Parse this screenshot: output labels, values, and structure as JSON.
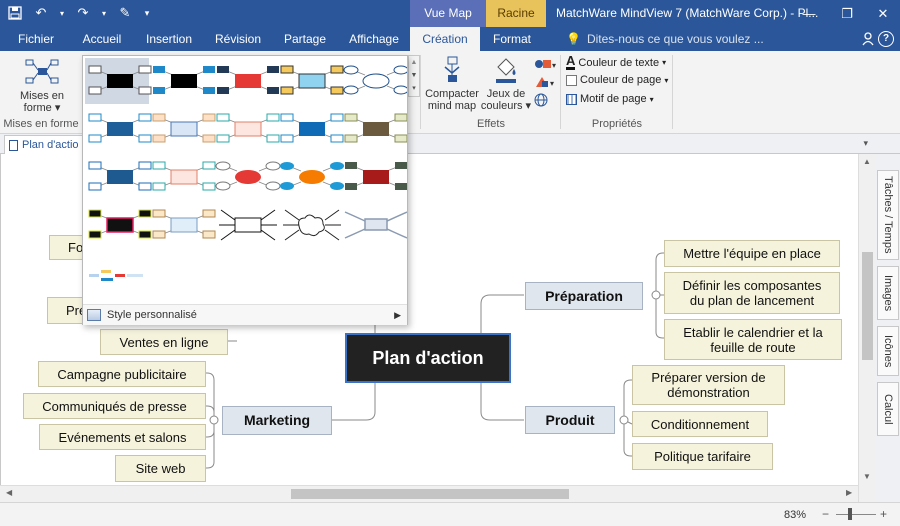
{
  "titlebar": {
    "title": "MatchWare MindView 7 (MatchWare Corp.) - Pl...",
    "context_group_left": "Vue Map",
    "context_group_right": "Racine",
    "color": "#2b579a"
  },
  "tabs": [
    {
      "label": "Fichier"
    },
    {
      "label": "Accueil"
    },
    {
      "label": "Insertion"
    },
    {
      "label": "Révision"
    },
    {
      "label": "Partage"
    },
    {
      "label": "Affichage"
    },
    {
      "label": "Création"
    },
    {
      "label": "Format"
    }
  ],
  "tellme": "Dites-nous ce que vous voulez ...",
  "ribbon": {
    "mises_en_forme_line1": "Mises en",
    "mises_en_forme_line2": "forme",
    "group_mises": "Mises en forme",
    "compacter_line1": "Compacter",
    "compacter_line2": "mind map",
    "jeux_line1": "Jeux de",
    "jeux_line2": "couleurs",
    "group_effets": "Effets",
    "couleur_texte": "Couleur de texte",
    "couleur_page": "Couleur de page",
    "motif_page": "Motif de page",
    "group_proprietes": "Propriétés"
  },
  "doc_tab": "Plan d'actio",
  "gallery": {
    "footer": "Style personnalisé"
  },
  "map": {
    "root": "Plan d'action",
    "branches": {
      "preparation": "Préparation",
      "produit": "Produit",
      "marketing": "Marketing"
    },
    "preparation_items": [
      "Mettre l'équipe en place",
      "Définir les composantes du plan de lancement",
      "Etablir le calendrier et la feuille de route"
    ],
    "produit_items": [
      "Préparer version de démonstration",
      "Conditionnement",
      "Politique tarifaire"
    ],
    "marketing_items": [
      "Campagne publicitaire",
      "Communiqués de presse",
      "Evénements et salons",
      "Site web"
    ],
    "left_upper_items": [
      "Fo",
      "Pré",
      "Ventes en ligne"
    ]
  },
  "side_tabs": [
    "Tâches / Temps",
    "Images",
    "Icônes",
    "Calcul"
  ],
  "status": {
    "zoom": "83%"
  }
}
